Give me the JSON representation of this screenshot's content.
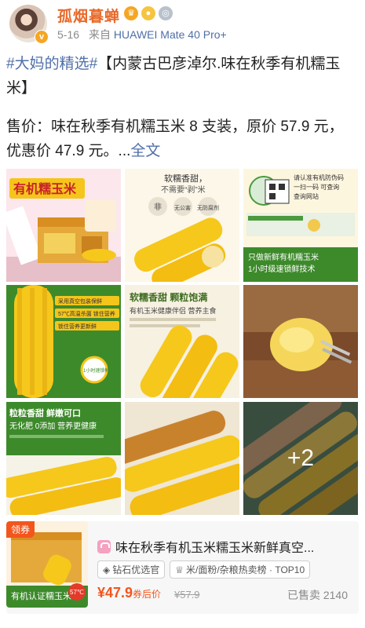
{
  "header": {
    "username": "孤烟暮蝉",
    "date": "5-16",
    "source_prefix": "来自",
    "device": "HUAWEI Mate 40 Pro+"
  },
  "post": {
    "hashtag": "#大妈的精选#",
    "title": "【内蒙古巴彦淖尔.味在秋季有机糯玉米】",
    "price_line_1": "售价：味在秋季有机糯玉米 8 支装，原价 57.9 元，",
    "price_line_2": "优惠价 47.9 元。...",
    "full_text": "全文"
  },
  "images": {
    "img1_title": "有机糯玉米",
    "img2_top": "软糯香甜，",
    "img2_sub": "不需要“剥”米",
    "img2_icon1": "非",
    "img2_icon2": "无公害",
    "img2_icon3": "无防腐剂",
    "img3_line1": "请认准有机防伪码",
    "img3_line2": "一扫一码  可查询",
    "img3_line3": "查询网站",
    "img3_bottom1": "只做新鲜有机糯玉米",
    "img3_bottom2": "1小时级速锁鲜技术",
    "img4_tag1": "采用真空包装保鲜",
    "img4_tag2": "57℃高温杀菌 锁住营养",
    "img4_tag3": "锁住营养更新鲜",
    "img4_badge": "1小时速锁鲜",
    "img5_title": "软糯香甜 颗粒饱满",
    "img5_sub": "有机玉米健康伴侣 营养主食",
    "img7_title1": "粒粒香甜 鲜嫩可口",
    "img7_title2": "无化肥 0添加 营养更健康",
    "more_count": "+2"
  },
  "product": {
    "coupon": "领券",
    "image_text": "有机认证糯玉米",
    "image_badge": "57℃",
    "title": "味在秋季有机玉米糯玉米新鲜真空...",
    "shop_chip": "钻石优选官",
    "category_chip": "米/面粉/杂粮热卖榜 · TOP10",
    "price": "¥47.9",
    "price_tag": "券后价",
    "original_price": "¥57.9",
    "sold": "已售卖 2140"
  },
  "colors": {
    "username": "#e8692a",
    "link": "#4f6fa8",
    "price": "#f2561d",
    "corn": "#f6c81b",
    "green": "#3d8a2b"
  }
}
